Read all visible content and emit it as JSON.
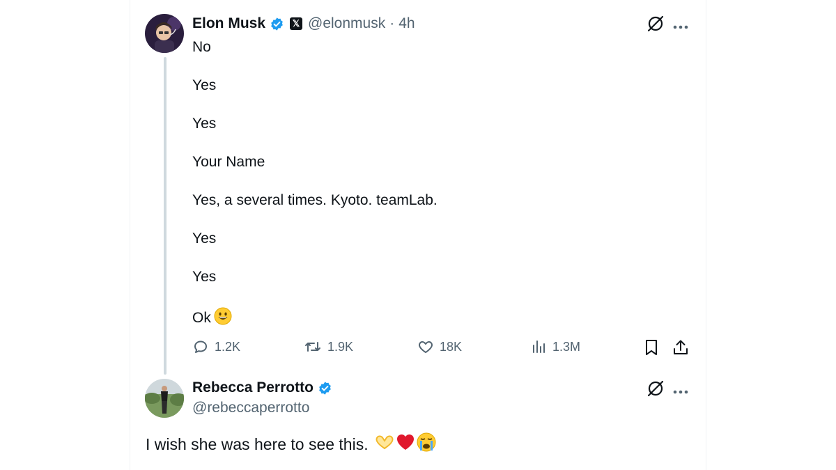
{
  "tweet": {
    "author_name": "Elon Musk",
    "handle": "@elonmusk",
    "separator": "·",
    "time": "4h",
    "x_badge": "𝕏",
    "lines": [
      "No",
      "Yes",
      "Yes",
      "Your Name",
      "Yes, a several times. Kyoto. teamLab.",
      "Yes",
      "Yes",
      "Ok"
    ],
    "stats": {
      "replies": "1.2K",
      "reposts": "1.9K",
      "likes": "18K",
      "views": "1.3M"
    }
  },
  "reply": {
    "author_name": "Rebecca Perrotto",
    "handle": "@rebeccaperrotto",
    "text": "I wish she was here to see this."
  },
  "colors": {
    "text": "#0f1419",
    "secondary": "#536471",
    "verified": "#1d9bf0",
    "thread_line": "#cfd9de"
  },
  "icons": [
    "verified-badge-icon",
    "x-logo-icon",
    "grok-icon",
    "more-icon",
    "reply-icon",
    "repost-icon",
    "like-icon",
    "views-icon",
    "bookmark-icon",
    "share-icon",
    "grinning-face-emoji",
    "heart-hands-emoji",
    "red-heart-emoji",
    "crying-face-emoji"
  ]
}
